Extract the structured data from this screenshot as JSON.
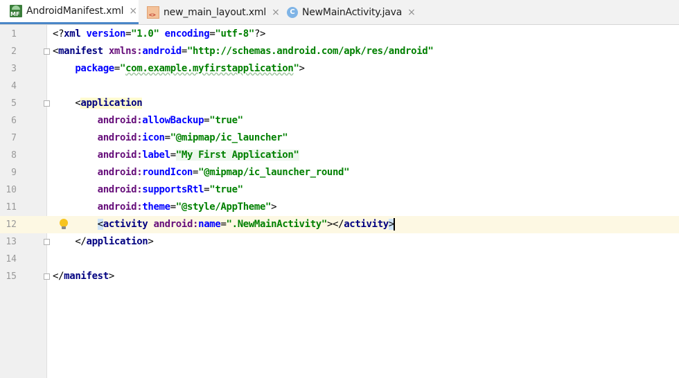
{
  "tabs": [
    {
      "label": "AndroidManifest.xml",
      "icon": "mf-icon",
      "icon_text": "MF",
      "active": true,
      "close": "×"
    },
    {
      "label": "new_main_layout.xml",
      "icon": "layout-icon",
      "icon_text": "<>",
      "active": false,
      "close": "×"
    },
    {
      "label": "NewMainActivity.java",
      "icon": "java-icon",
      "icon_text": "C",
      "active": false,
      "close": "×"
    }
  ],
  "editor": {
    "current_line": 12,
    "lines": [
      {
        "num": "1",
        "text": "<?xml version=\"1.0\" encoding=\"utf-8\"?>"
      },
      {
        "num": "2",
        "text": "<manifest xmlns:android=\"http://schemas.android.com/apk/res/android\""
      },
      {
        "num": "3",
        "text": "    package=\"com.example.myfirstapplication\">"
      },
      {
        "num": "4",
        "text": ""
      },
      {
        "num": "5",
        "text": "    <application"
      },
      {
        "num": "6",
        "text": "        android:allowBackup=\"true\""
      },
      {
        "num": "7",
        "text": "        android:icon=\"@mipmap/ic_launcher\""
      },
      {
        "num": "8",
        "text": "        android:label=\"My First Application\""
      },
      {
        "num": "9",
        "text": "        android:roundIcon=\"@mipmap/ic_launcher_round\""
      },
      {
        "num": "10",
        "text": "        android:supportsRtl=\"true\""
      },
      {
        "num": "11",
        "text": "        android:theme=\"@style/AppTheme\">"
      },
      {
        "num": "12",
        "text": "        <activity android:name=\".NewMainActivity\"></activity>"
      },
      {
        "num": "13",
        "text": "    </application>"
      },
      {
        "num": "14",
        "text": ""
      },
      {
        "num": "15",
        "text": "</manifest>"
      }
    ]
  },
  "colors": {
    "tag": "#000080",
    "namespace": "#660e7a",
    "attribute": "#0000ff",
    "string": "#008000",
    "current_line_bg": "#fdf8e3",
    "active_tab_underline": "#4a86c7"
  }
}
